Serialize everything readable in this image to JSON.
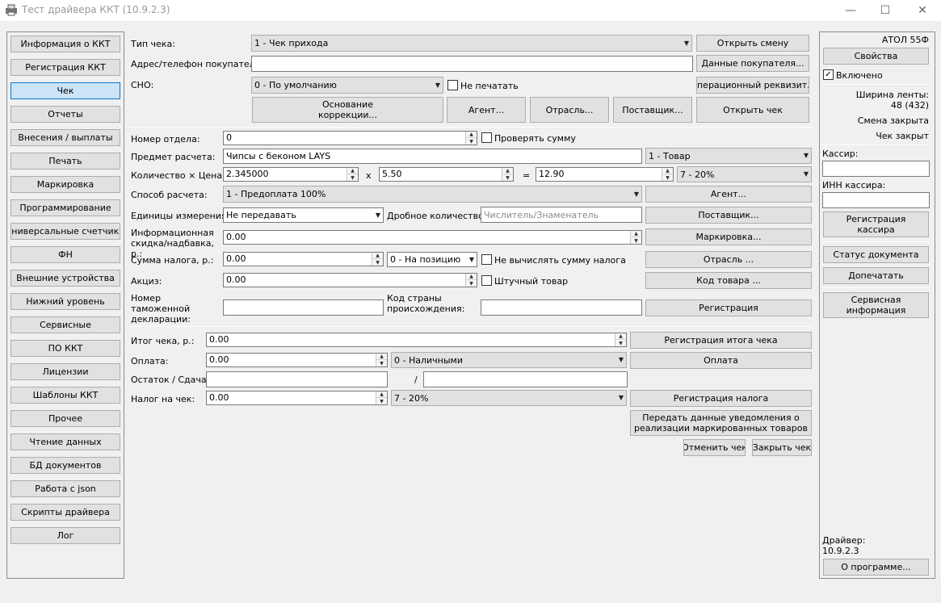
{
  "window": {
    "title": "Тест драйвера ККТ (10.9.2.3)",
    "minimize": "—",
    "maximize": "☐",
    "close": "✕"
  },
  "sidebar": {
    "items": [
      {
        "label": "Информация о ККТ"
      },
      {
        "label": "Регистрация ККТ"
      },
      {
        "label": "Чек",
        "selected": true
      },
      {
        "label": "Отчеты"
      },
      {
        "label": "Внесения / выплаты"
      },
      {
        "label": "Печать"
      },
      {
        "label": "Маркировка"
      },
      {
        "label": "Программирование"
      },
      {
        "label": "Универсальные счетчики"
      },
      {
        "label": "ФН"
      },
      {
        "label": "Внешние устройства"
      },
      {
        "label": "Нижний уровень"
      },
      {
        "label": "Сервисные"
      },
      {
        "label": "ПО ККТ"
      },
      {
        "label": "Лицензии"
      },
      {
        "label": "Шаблоны ККТ"
      },
      {
        "label": "Прочее"
      },
      {
        "label": "Чтение данных"
      },
      {
        "label": "БД документов"
      },
      {
        "label": "Работа с json"
      },
      {
        "label": "Скрипты драйвера"
      },
      {
        "label": "Лог"
      }
    ]
  },
  "receipt": {
    "type_label": "Тип чека:",
    "type_value": "1 - Чек прихода",
    "open_shift": "Открыть смену",
    "buyer_label": "Адрес/телефон покупателя:",
    "buyer_value": "",
    "buyer_data": "Данные покупателя...",
    "sno_label": "СНО:",
    "sno_value": "0 - По умолчанию",
    "no_print": "Не печатать",
    "op_requisite": "Операционный реквизит...",
    "correction": "Основание коррекции...",
    "agent": "Агент...",
    "industry": "Отрасль...",
    "supplier": "Поставщик...",
    "open_receipt": "Открыть чек"
  },
  "position": {
    "dept_label": "Номер отдела:",
    "dept_value": "0",
    "check_sum": "Проверять сумму",
    "subject_label": "Предмет расчета:",
    "subject_value": "Чипсы с беконом LAYS",
    "subject_type": "1 - Товар",
    "qty_label": "Количество × Цена:",
    "qty_value": "2.345000",
    "mul": "x",
    "price_value": "5.50",
    "eq": "=",
    "sum_value": "12.90",
    "vat": "7 - 20%",
    "method_label": "Способ расчета:",
    "method_value": "1 - Предоплата 100%",
    "agent": "Агент...",
    "unit_label": "Единицы измерения:",
    "unit_value": "Не передавать",
    "frac_label": "Дробное количество:",
    "frac_placeholder": "Числитель/Знаменатель",
    "supplier": "Поставщик...",
    "discount_label": "Информационная скидка/надбавка, р.:",
    "discount_value": "0.00",
    "marking": "Маркировка...",
    "tax_label": "Сумма налога, р.:",
    "tax_value": "0.00",
    "tax_mode": "0 - На позицию",
    "no_calc_tax": "Не вычислять сумму налога",
    "industry": "Отрасль ...",
    "excise_label": "Акциз:",
    "excise_value": "0.00",
    "piece": "Штучный товар",
    "product_code": "Код товара ...",
    "customs_label": "Номер таможенной декларации:",
    "country_label": "Код страны происхождения:",
    "register": "Регистрация"
  },
  "totals": {
    "total_label": "Итог чека, р.:",
    "total_value": "0.00",
    "register_total": "Регистрация итога чека",
    "payment_label": "Оплата:",
    "payment_value": "0.00",
    "payment_type": "0 - Наличными",
    "pay": "Оплата",
    "change_label": "Остаток / Сдача:",
    "slash": "/",
    "tax_label": "Налог на чек:",
    "tax_value": "0.00",
    "tax_vat": "7 - 20%",
    "register_tax": "Регистрация налога",
    "notify": "Передать данные уведомления о реализации маркированных товаров",
    "cancel": "Отменить чек",
    "close": "Закрыть чек"
  },
  "right": {
    "model": "АТОЛ 55Ф",
    "properties": "Свойства",
    "enabled": "Включено",
    "tape_width": "Ширина ленты:",
    "tape_value": "48 (432)",
    "shift": "Смена закрыта",
    "receipt": "Чек закрыт",
    "cashier_label": "Кассир:",
    "inn_label": "ИНН кассира:",
    "register_cashier": "Регистрация кассира",
    "doc_status": "Статус документа",
    "reprint": "Допечатать",
    "service": "Сервисная информация",
    "driver_label": "Драйвер:",
    "driver_version": "10.9.2.3",
    "about": "О программе..."
  }
}
